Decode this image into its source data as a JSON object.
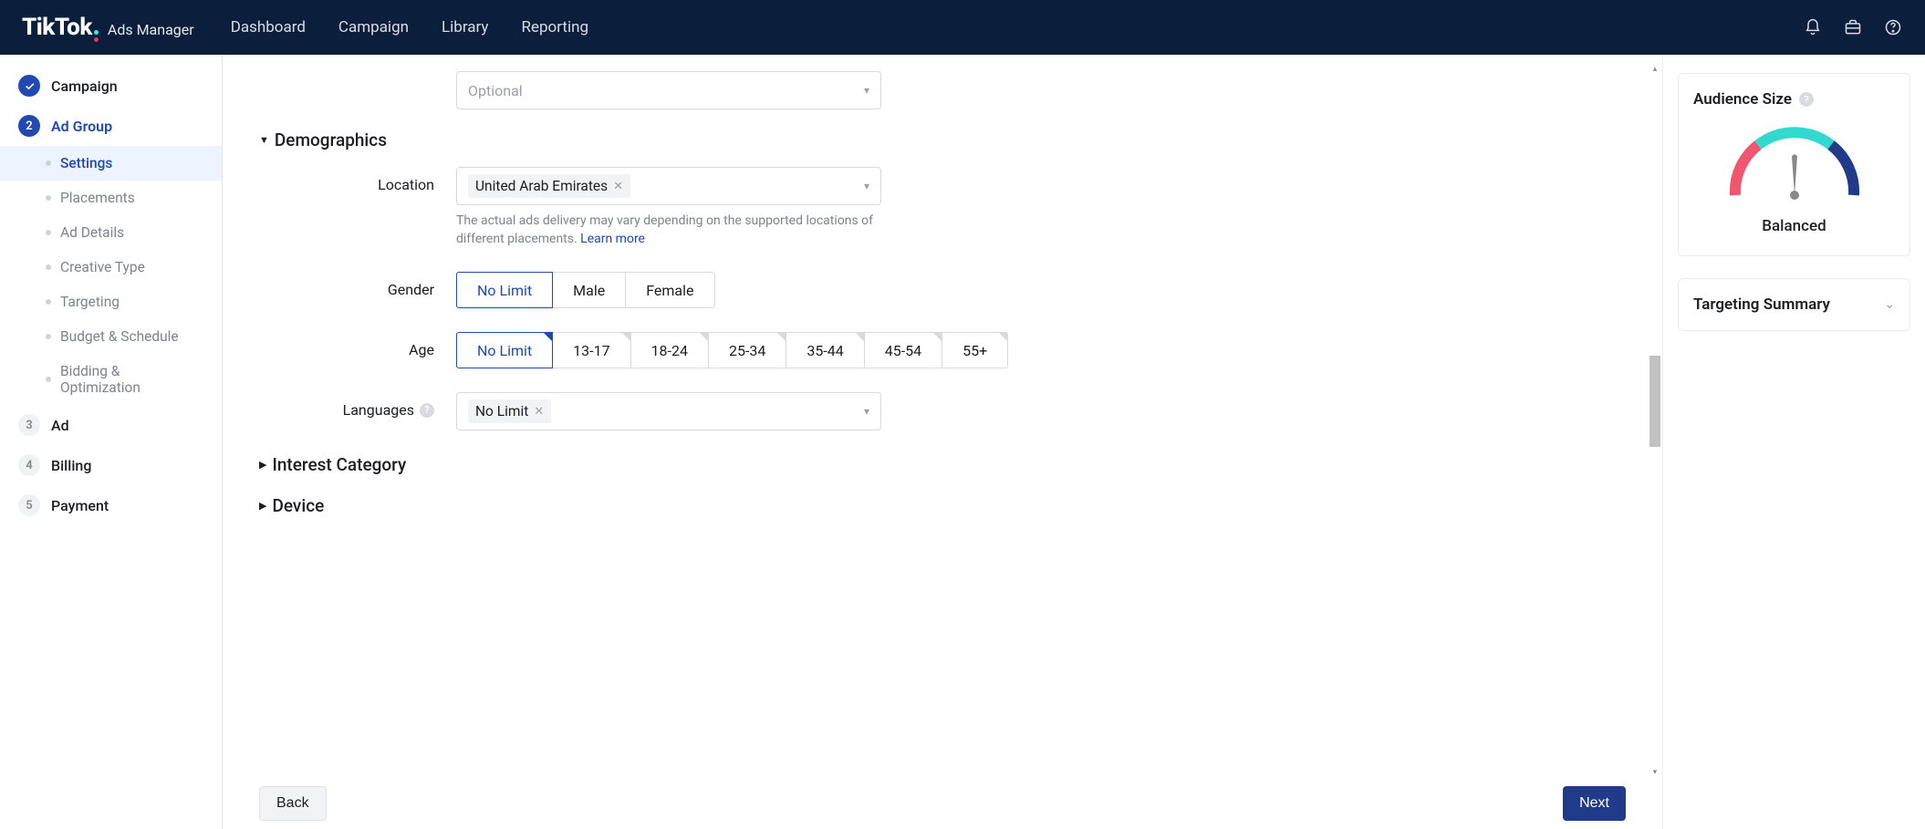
{
  "header": {
    "logo_main": "TikTok",
    "logo_sub": "Ads Manager",
    "nav": {
      "dashboard": "Dashboard",
      "campaign": "Campaign",
      "library": "Library",
      "reporting": "Reporting"
    }
  },
  "sidebar": {
    "step1": {
      "label": "Campaign"
    },
    "step2": {
      "num": "2",
      "label": "Ad Group",
      "items": {
        "settings": "Settings",
        "placements": "Placements",
        "ad_details": "Ad Details",
        "creative_type": "Creative Type",
        "targeting": "Targeting",
        "budget": "Budget & Schedule",
        "bidding": "Bidding & Optimization"
      }
    },
    "step3": {
      "num": "3",
      "label": "Ad"
    },
    "step4": {
      "num": "4",
      "label": "Billing"
    },
    "step5": {
      "num": "5",
      "label": "Payment"
    }
  },
  "form": {
    "optional_placeholder": "Optional",
    "demographics_title": "Demographics",
    "location": {
      "label": "Location",
      "chip": "United Arab Emirates",
      "helper_prefix": "The actual ads delivery may vary depending on the supported locations of different placements.  ",
      "helper_link": "Learn more"
    },
    "gender": {
      "label": "Gender",
      "options": {
        "no_limit": "No Limit",
        "male": "Male",
        "female": "Female"
      }
    },
    "age": {
      "label": "Age",
      "options": {
        "no_limit": "No Limit",
        "r1": "13-17",
        "r2": "18-24",
        "r3": "25-34",
        "r4": "35-44",
        "r5": "45-54",
        "r6": "55+"
      }
    },
    "languages": {
      "label": "Languages",
      "chip": "No Limit"
    },
    "interest_title": "Interest Category",
    "device_title": "Device",
    "back_btn": "Back",
    "next_btn": "Next"
  },
  "right": {
    "audience_title": "Audience Size",
    "audience_status": "Balanced",
    "targeting_title": "Targeting Summary"
  }
}
